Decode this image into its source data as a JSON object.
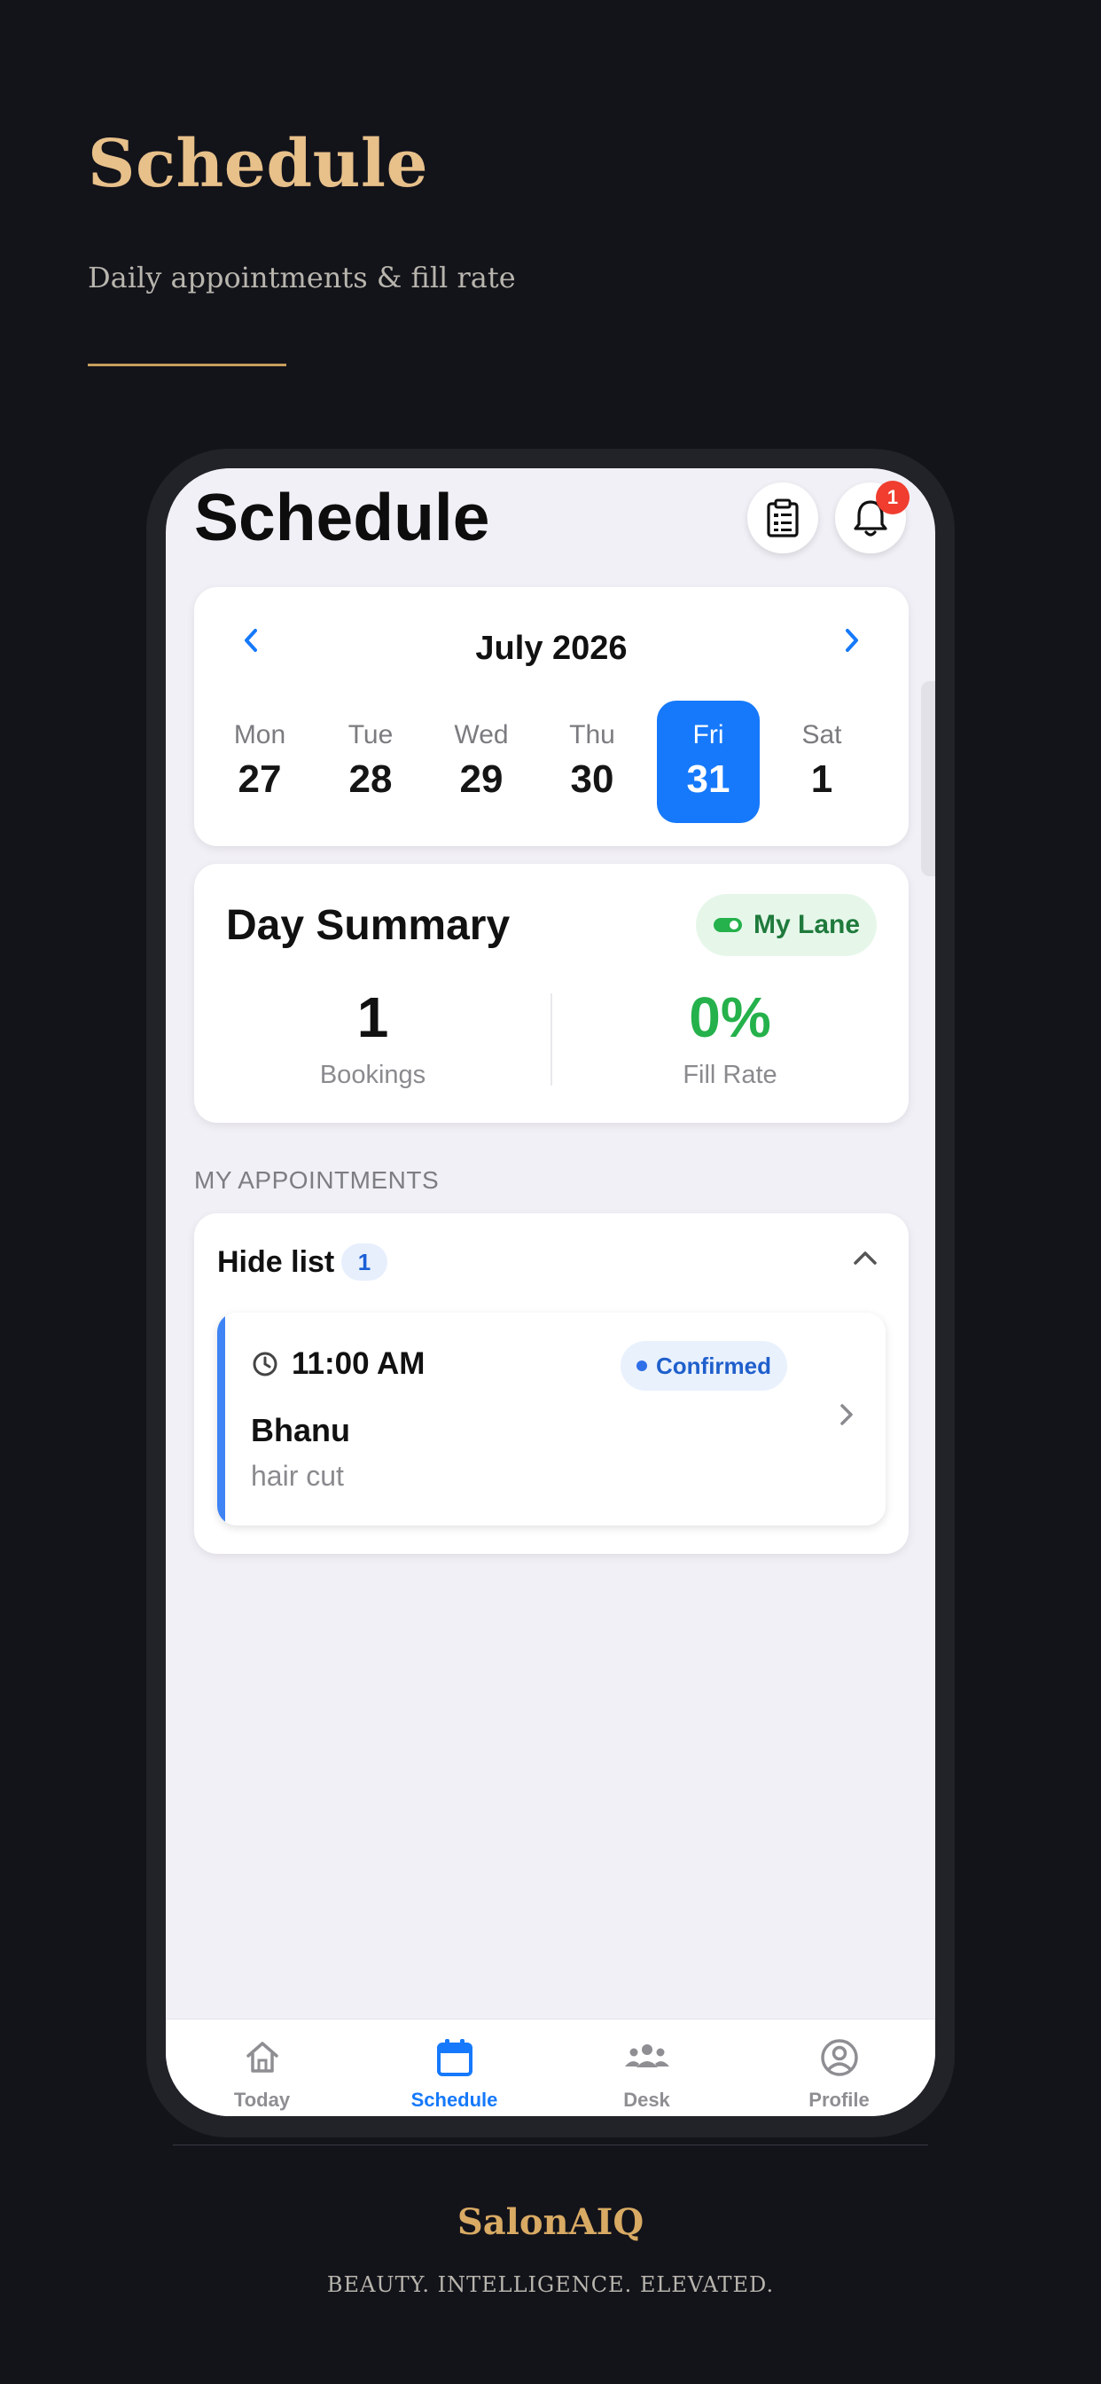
{
  "hero": {
    "title": "Schedule",
    "subtitle": "Daily appointments & fill rate"
  },
  "screen": {
    "title": "Schedule",
    "notification_count": "1"
  },
  "calendar": {
    "month": "July 2026",
    "days": [
      {
        "name": "Mon",
        "num": "27",
        "selected": false
      },
      {
        "name": "Tue",
        "num": "28",
        "selected": false
      },
      {
        "name": "Wed",
        "num": "29",
        "selected": false
      },
      {
        "name": "Thu",
        "num": "30",
        "selected": false
      },
      {
        "name": "Fri",
        "num": "31",
        "selected": true
      },
      {
        "name": "Sat",
        "num": "1",
        "selected": false
      }
    ]
  },
  "summary": {
    "title": "Day Summary",
    "lane_label": "My Lane",
    "bookings_value": "1",
    "bookings_label": "Bookings",
    "fill_value": "0%",
    "fill_label": "Fill Rate"
  },
  "appointments": {
    "section_label": "MY APPOINTMENTS",
    "toggle_label": "Hide list",
    "count": "1",
    "items": [
      {
        "time": "11:00 AM",
        "status": "Confirmed",
        "client": "Bhanu",
        "service": "hair cut"
      }
    ]
  },
  "tabbar": {
    "tabs": [
      {
        "label": "Today",
        "icon": "home-icon"
      },
      {
        "label": "Schedule",
        "icon": "calendar-icon",
        "active": true
      },
      {
        "label": "Desk",
        "icon": "team-icon"
      },
      {
        "label": "Profile",
        "icon": "profile-icon"
      }
    ]
  },
  "footer": {
    "brand": "SalonAIQ",
    "tagline": "BEAUTY. INTELLIGENCE. ELEVATED."
  },
  "colors": {
    "accent_gold": "#e7c08a",
    "primary_blue": "#1679fb",
    "success_green": "#25b14b",
    "badge_red": "#f03d2f"
  }
}
